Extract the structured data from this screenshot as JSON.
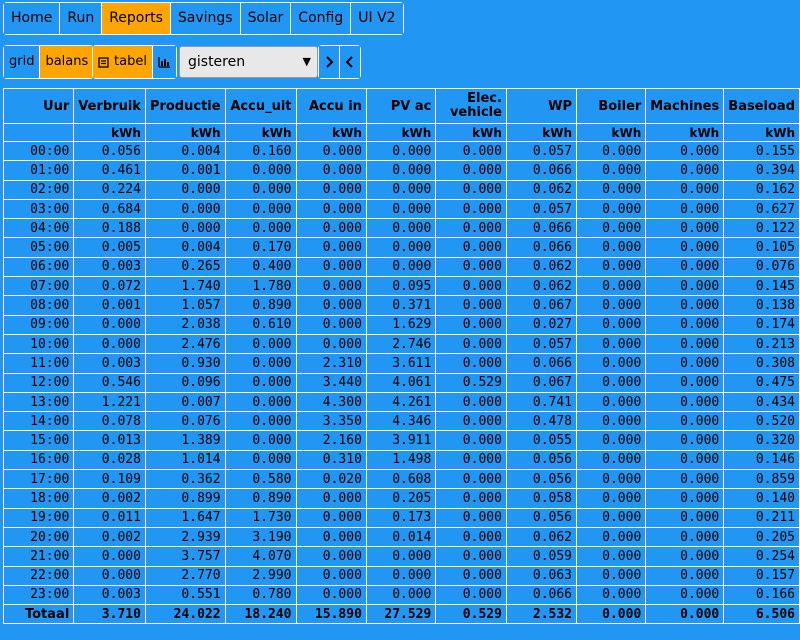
{
  "nav": {
    "items": [
      "Home",
      "Run",
      "Reports",
      "Savings",
      "Solar",
      "Config",
      "UI V2"
    ],
    "active_index": 2
  },
  "mode": {
    "items": [
      "grid",
      "balans"
    ],
    "active_index": 1
  },
  "view": {
    "tabel_label": "tabel"
  },
  "period": {
    "value": "gisteren"
  },
  "table": {
    "headers": [
      "Uur",
      "Verbruik",
      "Productie",
      "Accu_uit",
      "Accu in",
      "PV ac",
      "Elec. vehicle",
      "WP",
      "Boiler",
      "Machines",
      "Baseload"
    ],
    "units": [
      "",
      "kWh",
      "kWh",
      "kWh",
      "kWh",
      "kWh",
      "kWh",
      "kWh",
      "kWh",
      "kWh",
      "kWh"
    ],
    "rows": [
      [
        "00:00",
        "0.056",
        "0.004",
        "0.160",
        "0.000",
        "0.000",
        "0.000",
        "0.057",
        "0.000",
        "0.000",
        "0.155"
      ],
      [
        "01:00",
        "0.461",
        "0.001",
        "0.000",
        "0.000",
        "0.000",
        "0.000",
        "0.066",
        "0.000",
        "0.000",
        "0.394"
      ],
      [
        "02:00",
        "0.224",
        "0.000",
        "0.000",
        "0.000",
        "0.000",
        "0.000",
        "0.062",
        "0.000",
        "0.000",
        "0.162"
      ],
      [
        "03:00",
        "0.684",
        "0.000",
        "0.000",
        "0.000",
        "0.000",
        "0.000",
        "0.057",
        "0.000",
        "0.000",
        "0.627"
      ],
      [
        "04:00",
        "0.188",
        "0.000",
        "0.000",
        "0.000",
        "0.000",
        "0.000",
        "0.066",
        "0.000",
        "0.000",
        "0.122"
      ],
      [
        "05:00",
        "0.005",
        "0.004",
        "0.170",
        "0.000",
        "0.000",
        "0.000",
        "0.066",
        "0.000",
        "0.000",
        "0.105"
      ],
      [
        "06:00",
        "0.003",
        "0.265",
        "0.400",
        "0.000",
        "0.000",
        "0.000",
        "0.062",
        "0.000",
        "0.000",
        "0.076"
      ],
      [
        "07:00",
        "0.072",
        "1.740",
        "1.780",
        "0.000",
        "0.095",
        "0.000",
        "0.062",
        "0.000",
        "0.000",
        "0.145"
      ],
      [
        "08:00",
        "0.001",
        "1.057",
        "0.890",
        "0.000",
        "0.371",
        "0.000",
        "0.067",
        "0.000",
        "0.000",
        "0.138"
      ],
      [
        "09:00",
        "0.000",
        "2.038",
        "0.610",
        "0.000",
        "1.629",
        "0.000",
        "0.027",
        "0.000",
        "0.000",
        "0.174"
      ],
      [
        "10:00",
        "0.000",
        "2.476",
        "0.000",
        "0.000",
        "2.746",
        "0.000",
        "0.057",
        "0.000",
        "0.000",
        "0.213"
      ],
      [
        "11:00",
        "0.003",
        "0.930",
        "0.000",
        "2.310",
        "3.611",
        "0.000",
        "0.066",
        "0.000",
        "0.000",
        "0.308"
      ],
      [
        "12:00",
        "0.546",
        "0.096",
        "0.000",
        "3.440",
        "4.061",
        "0.529",
        "0.067",
        "0.000",
        "0.000",
        "0.475"
      ],
      [
        "13:00",
        "1.221",
        "0.007",
        "0.000",
        "4.300",
        "4.261",
        "0.000",
        "0.741",
        "0.000",
        "0.000",
        "0.434"
      ],
      [
        "14:00",
        "0.078",
        "0.076",
        "0.000",
        "3.350",
        "4.346",
        "0.000",
        "0.478",
        "0.000",
        "0.000",
        "0.520"
      ],
      [
        "15:00",
        "0.013",
        "1.389",
        "0.000",
        "2.160",
        "3.911",
        "0.000",
        "0.055",
        "0.000",
        "0.000",
        "0.320"
      ],
      [
        "16:00",
        "0.028",
        "1.014",
        "0.000",
        "0.310",
        "1.498",
        "0.000",
        "0.056",
        "0.000",
        "0.000",
        "0.146"
      ],
      [
        "17:00",
        "0.109",
        "0.362",
        "0.580",
        "0.020",
        "0.608",
        "0.000",
        "0.056",
        "0.000",
        "0.000",
        "0.859"
      ],
      [
        "18:00",
        "0.002",
        "0.899",
        "0.890",
        "0.000",
        "0.205",
        "0.000",
        "0.058",
        "0.000",
        "0.000",
        "0.140"
      ],
      [
        "19:00",
        "0.011",
        "1.647",
        "1.730",
        "0.000",
        "0.173",
        "0.000",
        "0.056",
        "0.000",
        "0.000",
        "0.211"
      ],
      [
        "20:00",
        "0.002",
        "2.939",
        "3.190",
        "0.000",
        "0.014",
        "0.000",
        "0.062",
        "0.000",
        "0.000",
        "0.205"
      ],
      [
        "21:00",
        "0.000",
        "3.757",
        "4.070",
        "0.000",
        "0.000",
        "0.000",
        "0.059",
        "0.000",
        "0.000",
        "0.254"
      ],
      [
        "22:00",
        "0.000",
        "2.770",
        "2.990",
        "0.000",
        "0.000",
        "0.000",
        "0.063",
        "0.000",
        "0.000",
        "0.157"
      ],
      [
        "23:00",
        "0.003",
        "0.551",
        "0.780",
        "0.000",
        "0.000",
        "0.000",
        "0.066",
        "0.000",
        "0.000",
        "0.166"
      ]
    ],
    "total": [
      "Totaal",
      "3.710",
      "24.022",
      "18.240",
      "15.890",
      "27.529",
      "0.529",
      "2.532",
      "0.000",
      "0.000",
      "6.506"
    ]
  },
  "colors": {
    "background": "#2196f3",
    "active": "#ffa500",
    "border": "#ffffff"
  },
  "icons": {
    "tabel": "table-icon",
    "grafiek": "bar-chart-icon",
    "next": "chevron-right-icon",
    "prev": "chevron-left-icon",
    "select": "chevron-down-icon"
  }
}
